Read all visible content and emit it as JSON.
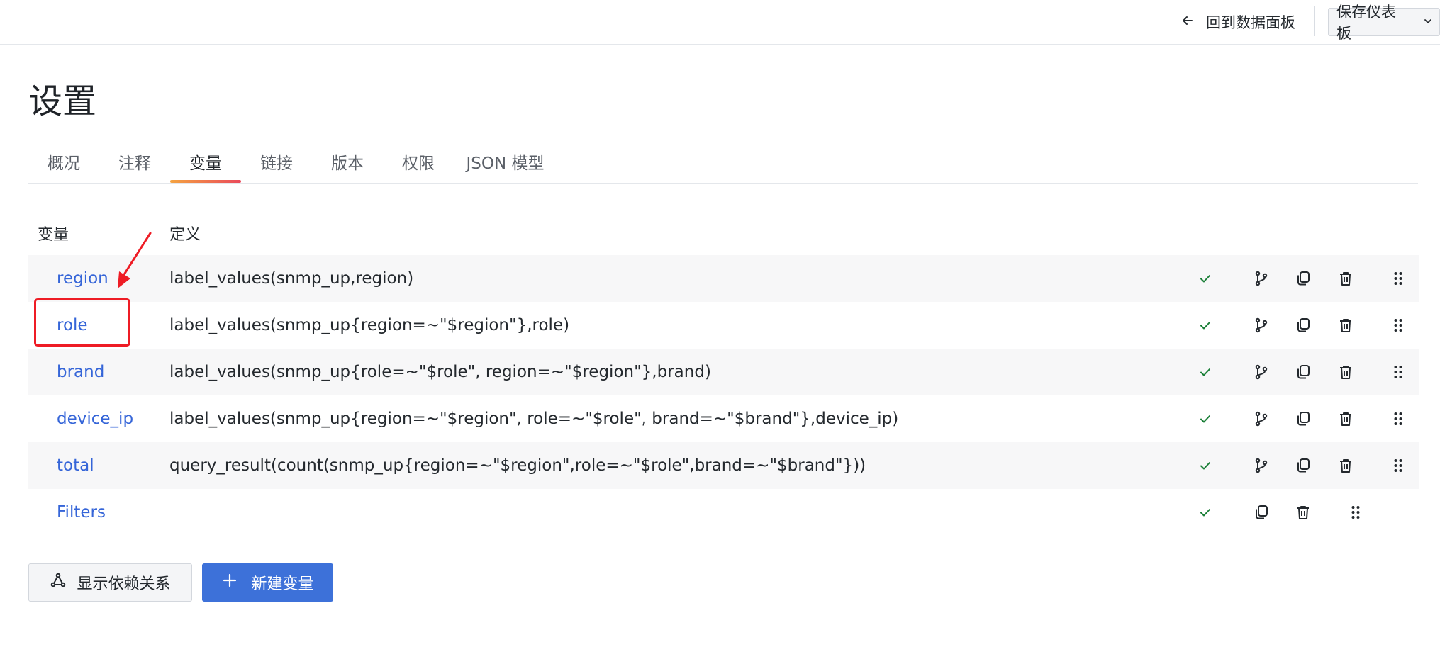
{
  "header": {
    "back_label": "回到数据面板",
    "save_label": "保存仪表板"
  },
  "page_title": "设置",
  "tabs": [
    {
      "label": "概况"
    },
    {
      "label": "注释"
    },
    {
      "label": "变量",
      "active": true
    },
    {
      "label": "链接"
    },
    {
      "label": "版本"
    },
    {
      "label": "权限"
    },
    {
      "label": "JSON 模型"
    }
  ],
  "table": {
    "col_variable": "变量",
    "col_definition": "定义",
    "rows": [
      {
        "name": "region",
        "definition": "label_values(snmp_up,region)"
      },
      {
        "name": "role",
        "definition": "label_values(snmp_up{region=~\"$region\"},role)"
      },
      {
        "name": "brand",
        "definition": "label_values(snmp_up{role=~\"$role\", region=~\"$region\"},brand)"
      },
      {
        "name": "device_ip",
        "definition": "label_values(snmp_up{region=~\"$region\", role=~\"$role\", brand=~\"$brand\"},device_ip)"
      },
      {
        "name": "total",
        "definition": "query_result(count(snmp_up{region=~\"$region\",role=~\"$role\",brand=~\"$brand\"}))"
      },
      {
        "name": "Filters",
        "definition": ""
      }
    ]
  },
  "buttons": {
    "show_deps": "显示依赖关系",
    "new_variable": "新建变量"
  },
  "icons": {
    "back": "arrow-left-icon",
    "caret": "chevron-down-icon",
    "status": "check-icon",
    "branch": "code-branch-icon",
    "duplicate": "copy-icon",
    "delete": "trash-icon",
    "drag": "drag-handle-icon",
    "deps": "graph-nodes-icon",
    "add": "plus-icon"
  },
  "colors": {
    "link": "#3565d8",
    "check": "#1a7f37",
    "primary_button": "#3d71d9",
    "tab_underline_start": "#f4a340",
    "tab_underline_end": "#ea4a5b",
    "annotation": "#ee1c25"
  }
}
